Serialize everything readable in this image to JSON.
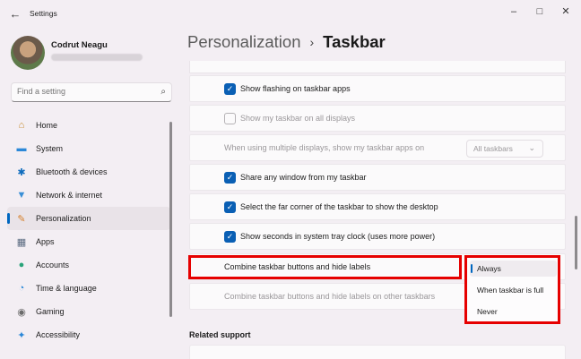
{
  "window": {
    "title": "Settings",
    "back_glyph": "←",
    "min_glyph": "–",
    "max_glyph": "□",
    "close_glyph": "✕"
  },
  "profile": {
    "name": "Codrut Neagu"
  },
  "search": {
    "placeholder": "Find a setting",
    "icon": "search-icon",
    "icon_glyph": "⌕"
  },
  "nav": {
    "items": [
      {
        "label": "Home",
        "icon": "home-icon",
        "glyph": "⌂",
        "color": "#c68a2b"
      },
      {
        "label": "System",
        "icon": "system-icon",
        "glyph": "▬",
        "color": "#2b88d8"
      },
      {
        "label": "Bluetooth & devices",
        "icon": "bluetooth-icon",
        "glyph": "✱",
        "color": "#0f6cbd"
      },
      {
        "label": "Network & internet",
        "icon": "wifi-icon",
        "glyph": "▼",
        "color": "#3a8fd6"
      },
      {
        "label": "Personalization",
        "icon": "brush-icon",
        "glyph": "✎",
        "color": "#d67f2a"
      },
      {
        "label": "Apps",
        "icon": "apps-icon",
        "glyph": "▦",
        "color": "#5a6b80"
      },
      {
        "label": "Accounts",
        "icon": "accounts-icon",
        "glyph": "●",
        "color": "#2aa37a"
      },
      {
        "label": "Time & language",
        "icon": "globe-icon",
        "glyph": "◔",
        "color": "#2b88d8"
      },
      {
        "label": "Gaming",
        "icon": "gaming-icon",
        "glyph": "◉",
        "color": "#6b6b6b"
      },
      {
        "label": "Accessibility",
        "icon": "accessibility-icon",
        "glyph": "✦",
        "color": "#2b88d8"
      }
    ],
    "active_index": 4
  },
  "breadcrumb": {
    "parent": "Personalization",
    "separator": "›",
    "current": "Taskbar"
  },
  "settings": {
    "checkmark": "✓",
    "show_flashing": "Show flashing on taskbar apps",
    "show_all_displays": "Show my taskbar on all displays",
    "multi_display_label": "When using multiple displays, show my taskbar apps on",
    "multi_display_value": "All taskbars",
    "chevron": "⌄",
    "share_window": "Share any window from my taskbar",
    "far_corner": "Select the far corner of the taskbar to show the desktop",
    "show_seconds": "Show seconds in system tray clock (uses more power)",
    "combine_buttons": "Combine taskbar buttons and hide labels",
    "combine_other": "Combine taskbar buttons and hide labels on other taskbars"
  },
  "combine_menu": {
    "options": [
      "Always",
      "When taskbar is full",
      "Never"
    ],
    "selected": "Always"
  },
  "related": {
    "title": "Related support"
  },
  "colors": {
    "accent": "#0067c0",
    "highlight": "#e60000",
    "checkbox": "#0a5fb4"
  }
}
